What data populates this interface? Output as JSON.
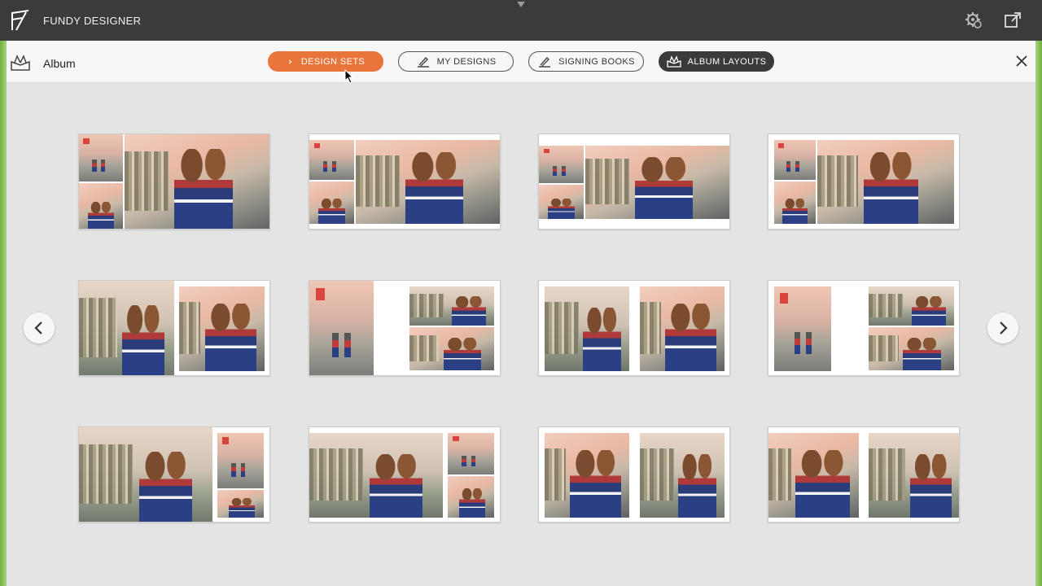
{
  "app": {
    "brand": "FUNDY DESIGNER"
  },
  "header": {
    "title": "Album"
  },
  "tabs": [
    {
      "label": "DESIGN SETS",
      "state": "active"
    },
    {
      "label": "MY DESIGNS",
      "state": "outline"
    },
    {
      "label": "SIGNING BOOKS",
      "state": "outline"
    },
    {
      "label": "ALBUM LAYOUTS",
      "state": "dark"
    }
  ],
  "icons": {
    "brand": "fundy-logo-icon",
    "gear": "settings-gear-icon",
    "external": "external-window-icon",
    "album": "album-book-icon",
    "close": "close-icon",
    "prev": "chevron-left-icon",
    "next": "chevron-right-icon"
  },
  "colors": {
    "accent": "#e9753a",
    "topbar": "#3b3b3b",
    "panel": "#e4e4e4"
  },
  "layouts": [
    {
      "photos": 3
    },
    {
      "photos": 3
    },
    {
      "photos": 3
    },
    {
      "photos": 3
    },
    {
      "photos": 2
    },
    {
      "photos": 3
    },
    {
      "photos": 2
    },
    {
      "photos": 3
    },
    {
      "photos": 3
    },
    {
      "photos": 3
    },
    {
      "photos": 2
    },
    {
      "photos": 2
    }
  ]
}
